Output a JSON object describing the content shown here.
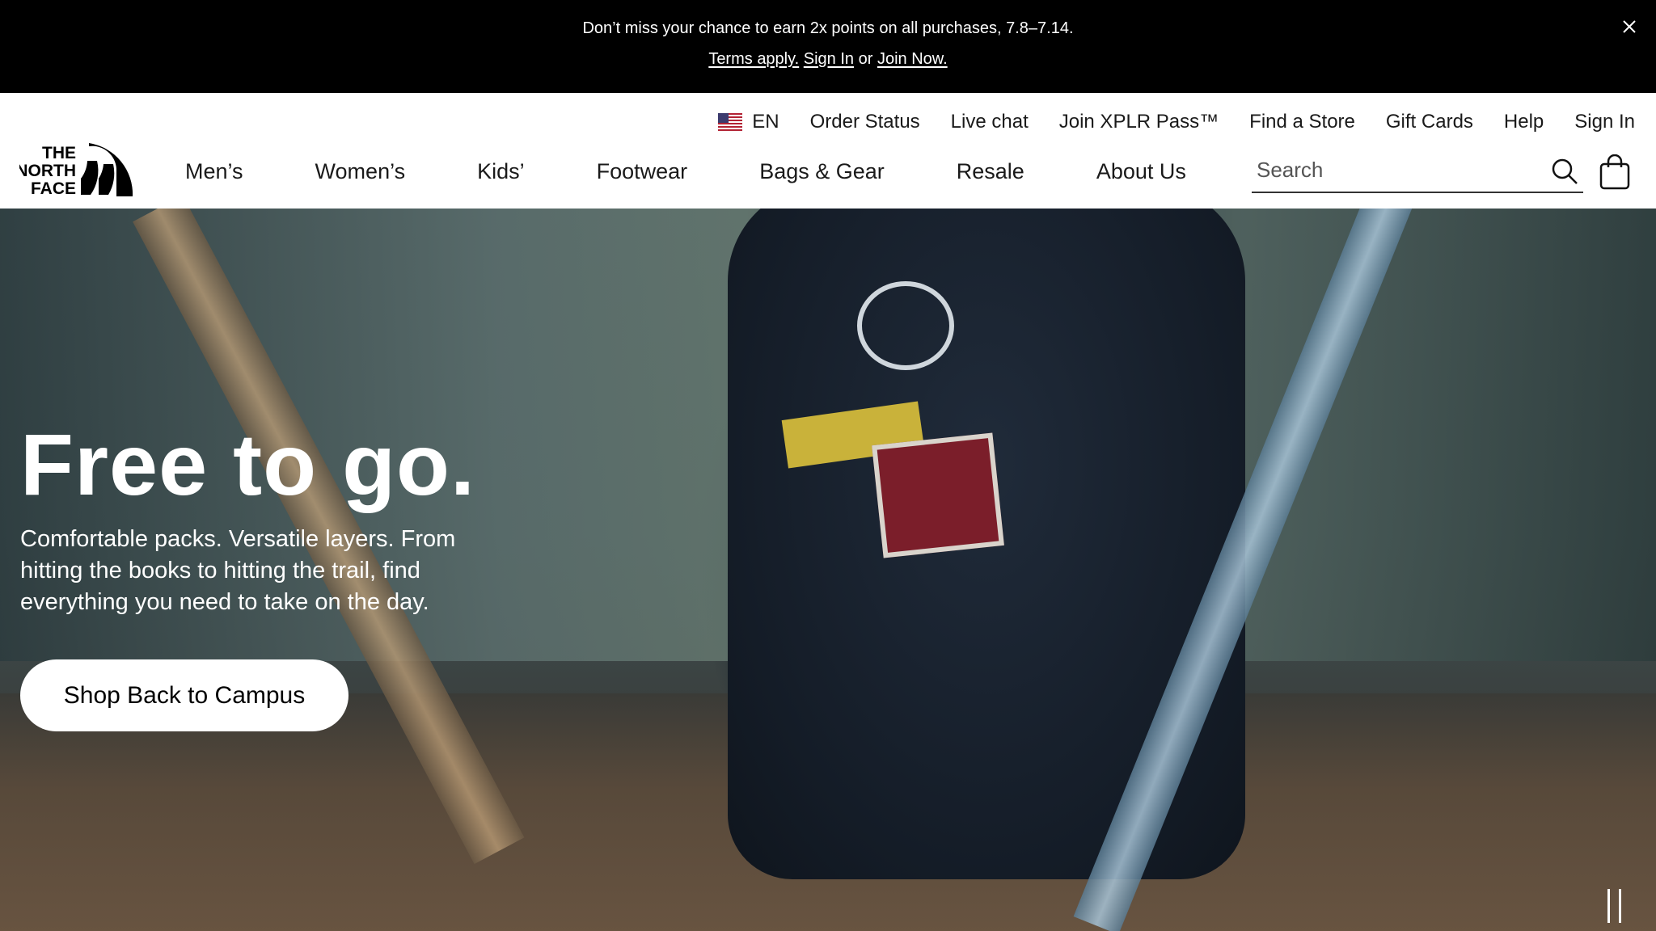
{
  "promo": {
    "message": "Don’t miss your chance to earn 2x points on all purchases, 7.8–7.14.",
    "terms": "Terms apply.",
    "sign_in": "Sign In",
    "or": "or",
    "join": "Join Now."
  },
  "utility": {
    "language": "EN",
    "links": [
      "Order Status",
      "Live chat",
      "Join XPLR Pass™",
      "Find a Store",
      "Gift Cards",
      "Help",
      "Sign In"
    ]
  },
  "logo": {
    "line1": "THE",
    "line2": "NORTH",
    "line3": "FACE"
  },
  "nav": [
    "Men’s",
    "Women’s",
    "Kids’",
    "Footwear",
    "Bags & Gear",
    "Resale",
    "About Us"
  ],
  "search": {
    "placeholder": "Search"
  },
  "hero": {
    "title": "Free to go.",
    "subtitle": "Comfortable packs. Versatile layers. From hitting the books to hitting the trail, find everything you need to take on the day.",
    "cta": "Shop Back to Campus"
  },
  "colors": {
    "banner_bg": "#000000",
    "header_bg": "#ffffff",
    "cta_bg": "#ffffff",
    "text_light": "#ffffff"
  }
}
